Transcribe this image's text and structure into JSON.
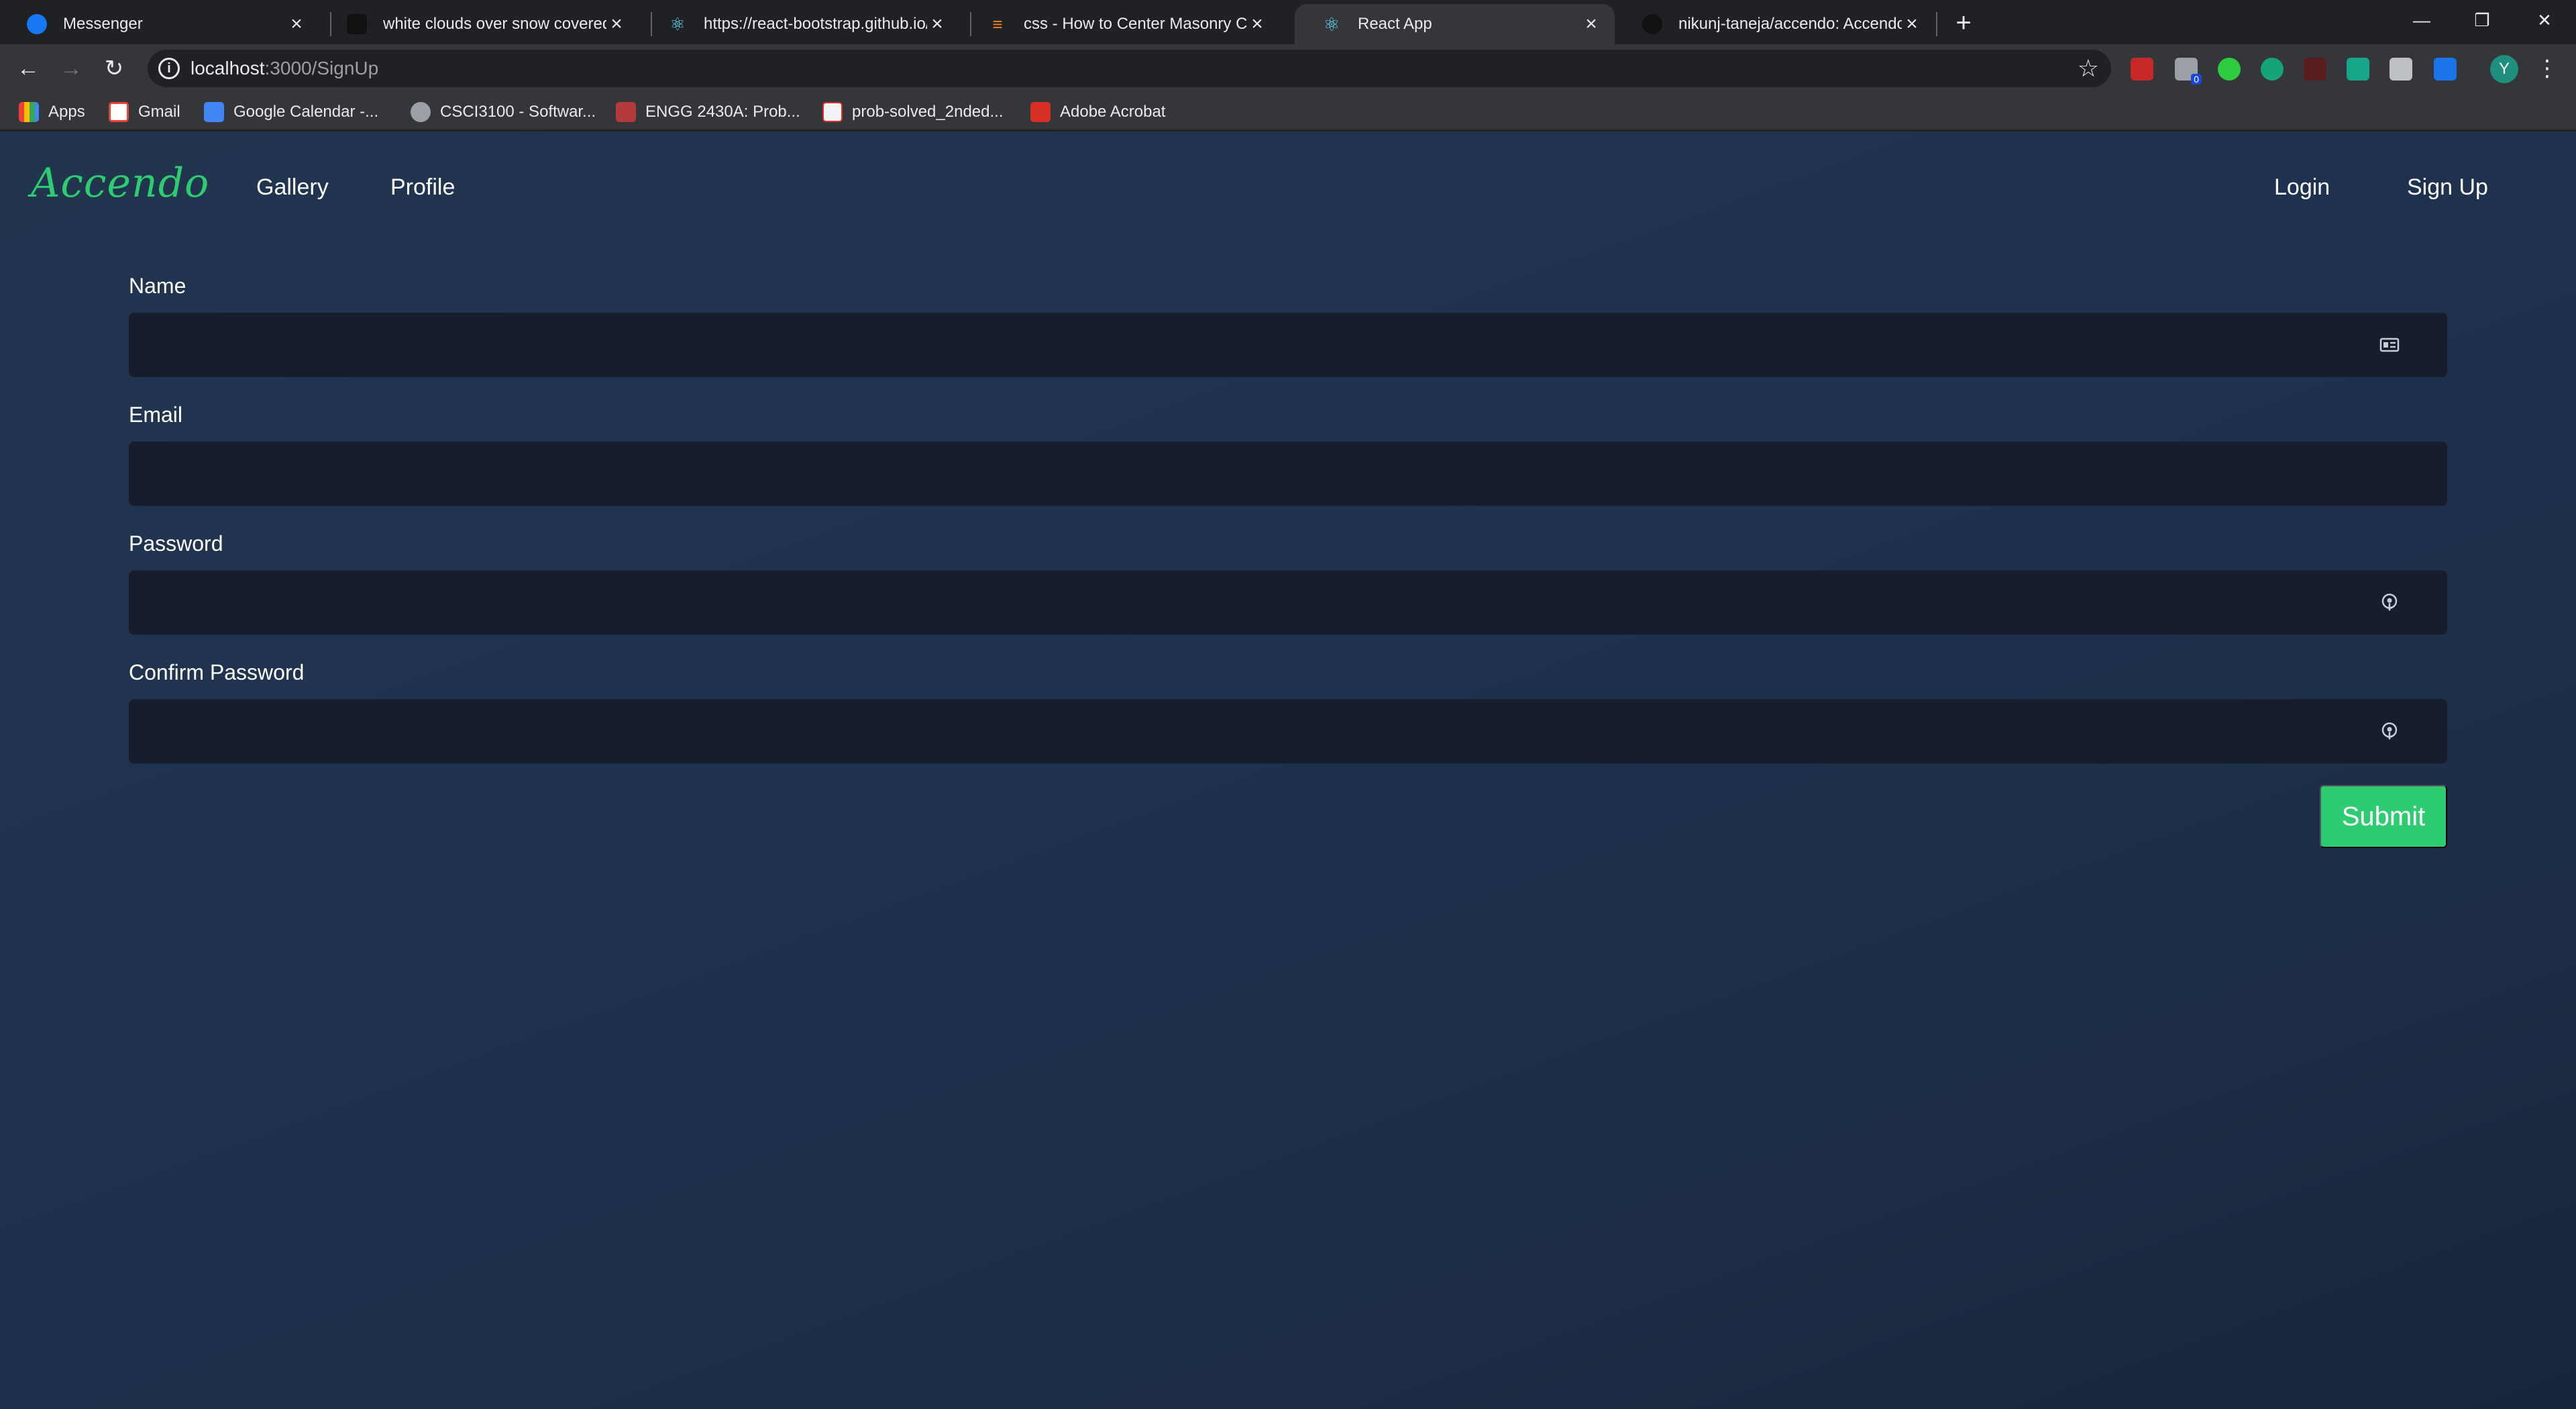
{
  "browser": {
    "tabs": [
      {
        "title": "Messenger"
      },
      {
        "title": "white clouds over snow covered"
      },
      {
        "title": "https://react-bootstrap.github.io/"
      },
      {
        "title": "css - How to Center Masonry Co"
      },
      {
        "title": "React App"
      },
      {
        "title": "nikunj-taneja/accendo: Accendo"
      }
    ],
    "new_tab": "+",
    "window_controls": {
      "minimize": "—",
      "restore": "❐",
      "close": "✕"
    },
    "address": {
      "host": "localhost",
      "path": ":3000/SignUp"
    },
    "profile_initial": "Y",
    "bookmarks": [
      {
        "label": "Apps"
      },
      {
        "label": "Gmail"
      },
      {
        "label": "Google Calendar -..."
      },
      {
        "label": "CSCI3100 - Softwar..."
      },
      {
        "label": "ENGG 2430A: Prob..."
      },
      {
        "label": "prob-solved_2nded..."
      },
      {
        "label": "Adobe Acrobat"
      }
    ],
    "extension_badge": "0"
  },
  "navbar": {
    "brand": "Accendo",
    "links": {
      "gallery": "Gallery",
      "profile": "Profile"
    },
    "auth": {
      "login": "Login",
      "signup": "Sign Up"
    }
  },
  "form": {
    "name_label": "Name",
    "email_label": "Email",
    "password_label": "Password",
    "confirm_label": "Confirm Password",
    "name_value": "",
    "email_value": "",
    "password_value": "",
    "confirm_value": "",
    "submit_label": "Submit"
  },
  "colors": {
    "accent": "#2ecc71",
    "page_bg": "#1f3350",
    "field_bg": "#161d2d"
  }
}
